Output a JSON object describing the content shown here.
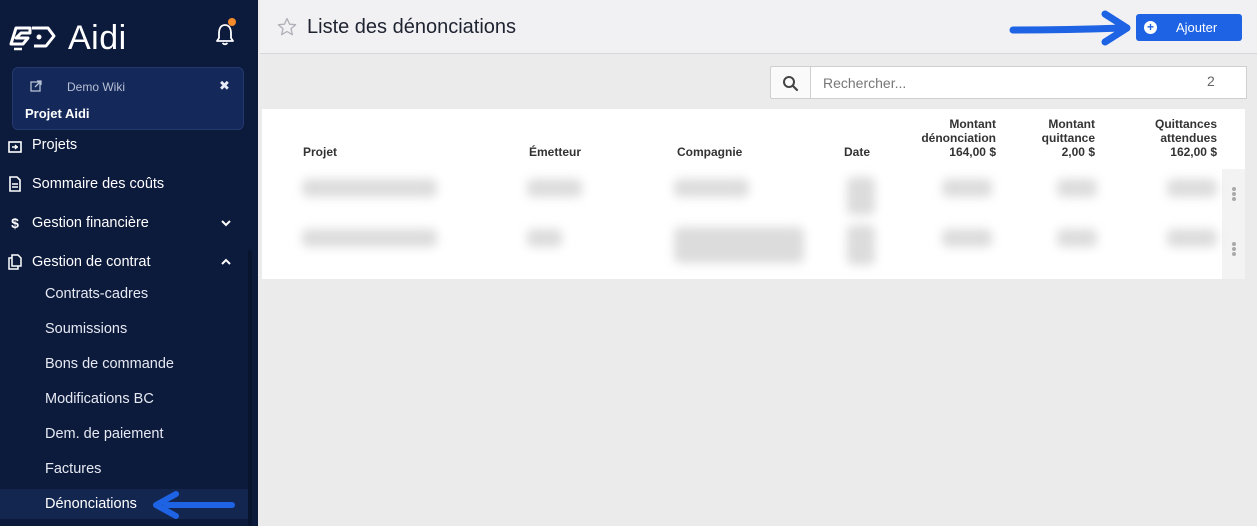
{
  "app": {
    "name": "Aidi"
  },
  "project_card": {
    "wiki_label": "Demo Wiki",
    "project_name": "Projet Aidi",
    "close_symbol": "✖"
  },
  "nav": {
    "projets": "Projets",
    "sommaire": "Sommaire des coûts",
    "gestion_financiere": "Gestion financière",
    "gestion_contrat": "Gestion de contrat",
    "sub_items": [
      "Contrats-cadres",
      "Soumissions",
      "Bons de commande",
      "Modifications BC",
      "Dem. de paiement",
      "Factures",
      "Dénonciations"
    ],
    "active": "Dénonciations"
  },
  "header": {
    "title": "Liste des dénonciations",
    "add_label": "Ajouter"
  },
  "search": {
    "placeholder": "Rechercher...",
    "count": "2"
  },
  "table": {
    "columns": {
      "projet": "Projet",
      "emetteur": "Émetteur",
      "compagnie": "Compagnie",
      "date": "Date",
      "montant_denonciation": [
        "Montant",
        "dénonciation",
        "164,00 $"
      ],
      "montant_quittance": [
        "Montant",
        "quittance",
        "2,00 $"
      ],
      "quittances_attendues": [
        "Quittances",
        "attendues",
        "162,00 $"
      ]
    },
    "row_count": 2
  },
  "colors": {
    "sidebar": "#0c1a3c",
    "accent": "#1d63e4",
    "notification": "#f58a2b"
  }
}
